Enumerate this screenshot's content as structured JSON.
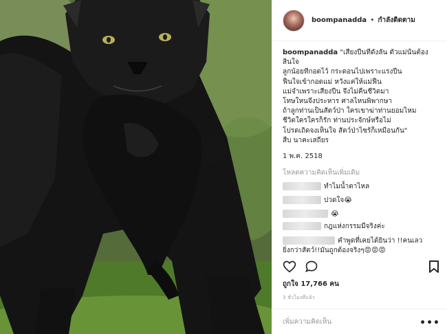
{
  "header": {
    "username": "boompanadda",
    "separator": "•",
    "follow_label": "กำลังติดตาม"
  },
  "caption": {
    "username": "boompanadda",
    "first_line": "\"เสียงปืนที่ดังลั่น ตัวแม่นั้นต้อง",
    "lines": [
      "สิ้นใจ",
      "ลูกน้อยที่กอดไว้ กระดอนไปเพราะแรงปืน",
      "ฟื้นใจเข้ากอดแม่ หวังแค่ให้แม่ฟื้น",
      "แม่จำเพราะเสียงปืน จึงไม่คืนชีวิตมา",
      "โทษใหนจึงประหาร ศาลไหนพิพากษา",
      "ถ้าลูกท่านเป็นสัตว์ป่า ใครเขาฆ่าท่านยอมไหม",
      "ชีวิตใครใครก็รัก ท่านประจักษ์หรือไม่",
      "โปรดเถิดจงเห็นใจ สัตว์ป่าไซร้ก็เหมือนกัน\"",
      "สืบ นาคะเสถียร"
    ],
    "date": "1 พ.ค. 2518"
  },
  "load_more": "โหลดความคิดเห็นเพิ่มเติม",
  "comments": [
    {
      "text": "ทำไมน้ำตาไหล"
    },
    {
      "text": "ปวดใจ😭"
    },
    {
      "text": "😭"
    },
    {
      "text": "กฎแห่งกรรมมีจริงค่ะ"
    },
    {
      "text": "คำพูดที่เคยได้ยินว่า !!คนเลว"
    },
    {
      "text": "ยิ่งกว่าสัตว์!!มันถูกต้องจริงๆ😡😡😡"
    }
  ],
  "likes": "ถูกใจ 17,766 คน",
  "time_ago": "3 ชั่วโมงที่แล้ว",
  "add_comment_placeholder": "เพิ่มความคิดเห็น",
  "more_label": "•••",
  "icons": [
    "heart-icon",
    "comment-icon",
    "bookmark-icon"
  ]
}
